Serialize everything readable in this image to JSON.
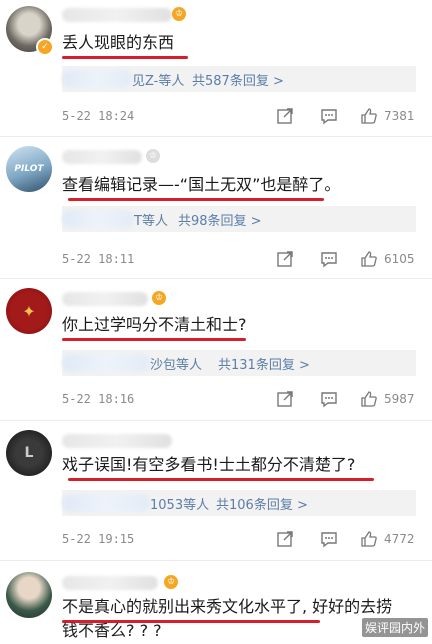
{
  "comments": [
    {
      "name_fragment": "",
      "text": "丢人现眼的东西",
      "reply_who": "见Z-等人",
      "reply_count": "共587条回复 >",
      "date": "5-22 18:24",
      "likes": "7381"
    },
    {
      "name_fragment": "",
      "text": "查看编辑记录—-“国土无双”也是醉了。",
      "reply_who": "T等人",
      "reply_count": "共98条回复 >",
      "date": "5-22 18:11",
      "likes": "6105"
    },
    {
      "name_fragment": "",
      "text": "你上过学吗分不清土和士?",
      "reply_who": "沙包等人",
      "reply_count": "共131条回复 >",
      "date": "5-22 18:16",
      "likes": "5987"
    },
    {
      "name_fragment": "",
      "text": "戏子误国!有空多看书!士土都分不清楚了?",
      "reply_who": "1053等人",
      "reply_count": "共106条回复 >",
      "date": "5-22 19:15",
      "likes": "4772"
    },
    {
      "name_fragment": "",
      "text_line1": "不是真心的就别出来秀文化水平了, 好好的去捞",
      "text_line2": "钱不香么? ? ?"
    }
  ],
  "watermark": "娱评园内外",
  "colors": {
    "underline": "#d81e2a",
    "link": "#5b7ea8",
    "badge": "#f5a623"
  },
  "icons": {
    "share": "share-icon",
    "comment": "comment-icon",
    "like": "thumbs-up-icon",
    "verified": "verified-badge-icon"
  }
}
